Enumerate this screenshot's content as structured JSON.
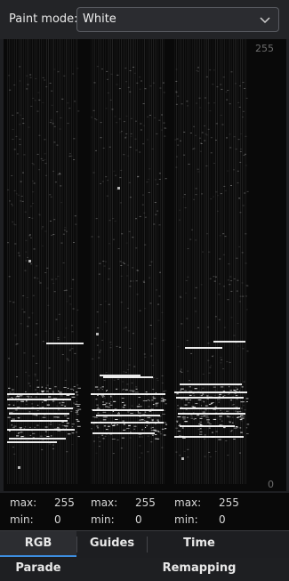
{
  "toolbar": {
    "paint_mode_label": "Paint mode:",
    "paint_mode_value": "White"
  },
  "scope": {
    "scale_max": "255",
    "scale_min": "0"
  },
  "stats": [
    {
      "max_label": "max:",
      "max_value": "255",
      "min_label": "min:",
      "min_value": "0"
    },
    {
      "max_label": "max:",
      "max_value": "255",
      "min_label": "min:",
      "min_value": "0"
    },
    {
      "max_label": "max:",
      "max_value": "255",
      "min_label": "min:",
      "min_value": "0"
    }
  ],
  "tabs": [
    {
      "label": "RGB Parade",
      "active": true
    },
    {
      "label": "Guides",
      "active": false
    },
    {
      "label": "Time Remapping",
      "active": false
    }
  ],
  "colors": {
    "background": "#090909",
    "trace": "#ffffff",
    "tab_accent": "#3d8ee0"
  }
}
